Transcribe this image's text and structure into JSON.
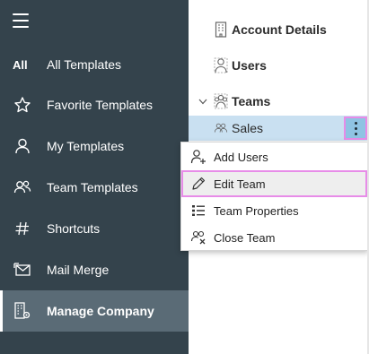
{
  "sidebar": {
    "items": [
      {
        "icon": "all-text",
        "icon_text": "All",
        "label": "All Templates"
      },
      {
        "icon": "star-icon",
        "label": "Favorite Templates"
      },
      {
        "icon": "person-icon",
        "label": "My Templates"
      },
      {
        "icon": "people-icon",
        "label": "Team Templates"
      },
      {
        "icon": "hash-icon",
        "label": "Shortcuts"
      },
      {
        "icon": "mail-merge-icon",
        "label": "Mail Merge"
      },
      {
        "icon": "company-settings-icon",
        "label": "Manage Company",
        "active": true
      }
    ]
  },
  "panel": {
    "account_details": "Account Details",
    "users": "Users",
    "teams": "Teams",
    "sales": "Sales"
  },
  "context_menu": {
    "items": [
      {
        "icon": "add-user-icon",
        "label": "Add Users"
      },
      {
        "icon": "edit-pencil-icon",
        "label": "Edit Team",
        "highlighted": true
      },
      {
        "icon": "list-icon",
        "label": "Team Properties"
      },
      {
        "icon": "close-team-icon",
        "label": "Close Team"
      }
    ]
  },
  "colors": {
    "sidebar_bg": "#34434c",
    "sidebar_active_bg": "#5a6b76",
    "selected_row_bg": "#c9e0f1",
    "highlight_border": "#e78ce8"
  }
}
